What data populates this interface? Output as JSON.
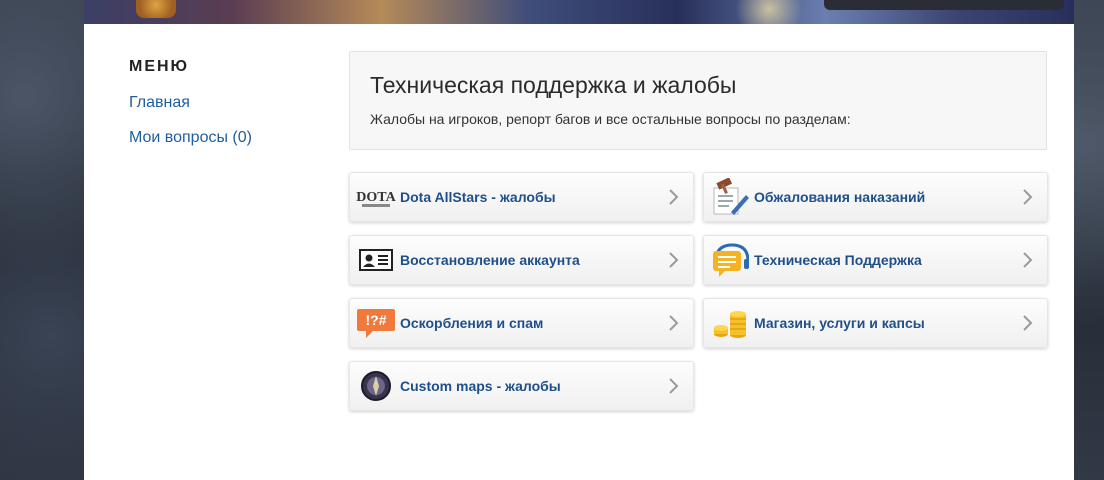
{
  "menu": {
    "title": "МЕНЮ",
    "items": [
      {
        "label": "Главная"
      },
      {
        "label": "Мои вопросы (0)"
      }
    ]
  },
  "header": {
    "title": "Техническая поддержка и жалобы",
    "description": "Жалобы на игроков, репорт багов и все остальные вопросы по разделам:"
  },
  "categories": [
    {
      "label": "Dota AllStars - жалобы",
      "icon": "dota-logo-icon"
    },
    {
      "label": "Обжалования наказаний",
      "icon": "gavel-document-icon"
    },
    {
      "label": "Восстановление аккаунта",
      "icon": "id-card-icon"
    },
    {
      "label": "Техническая Поддержка",
      "icon": "headset-chat-icon"
    },
    {
      "label": "Оскорбления и спам",
      "icon": "swear-symbols-icon"
    },
    {
      "label": "Магазин, услуги и капсы",
      "icon": "coins-icon"
    },
    {
      "label": "Custom maps - жалобы",
      "icon": "custom-maps-emblem-icon"
    }
  ],
  "icon_text": {
    "dota_logo": "DOTA",
    "swear": "!?#"
  },
  "colors": {
    "link": "#1f5e9e",
    "card_label": "#1f4f8a",
    "panel_bg": "#f7f7f7"
  }
}
